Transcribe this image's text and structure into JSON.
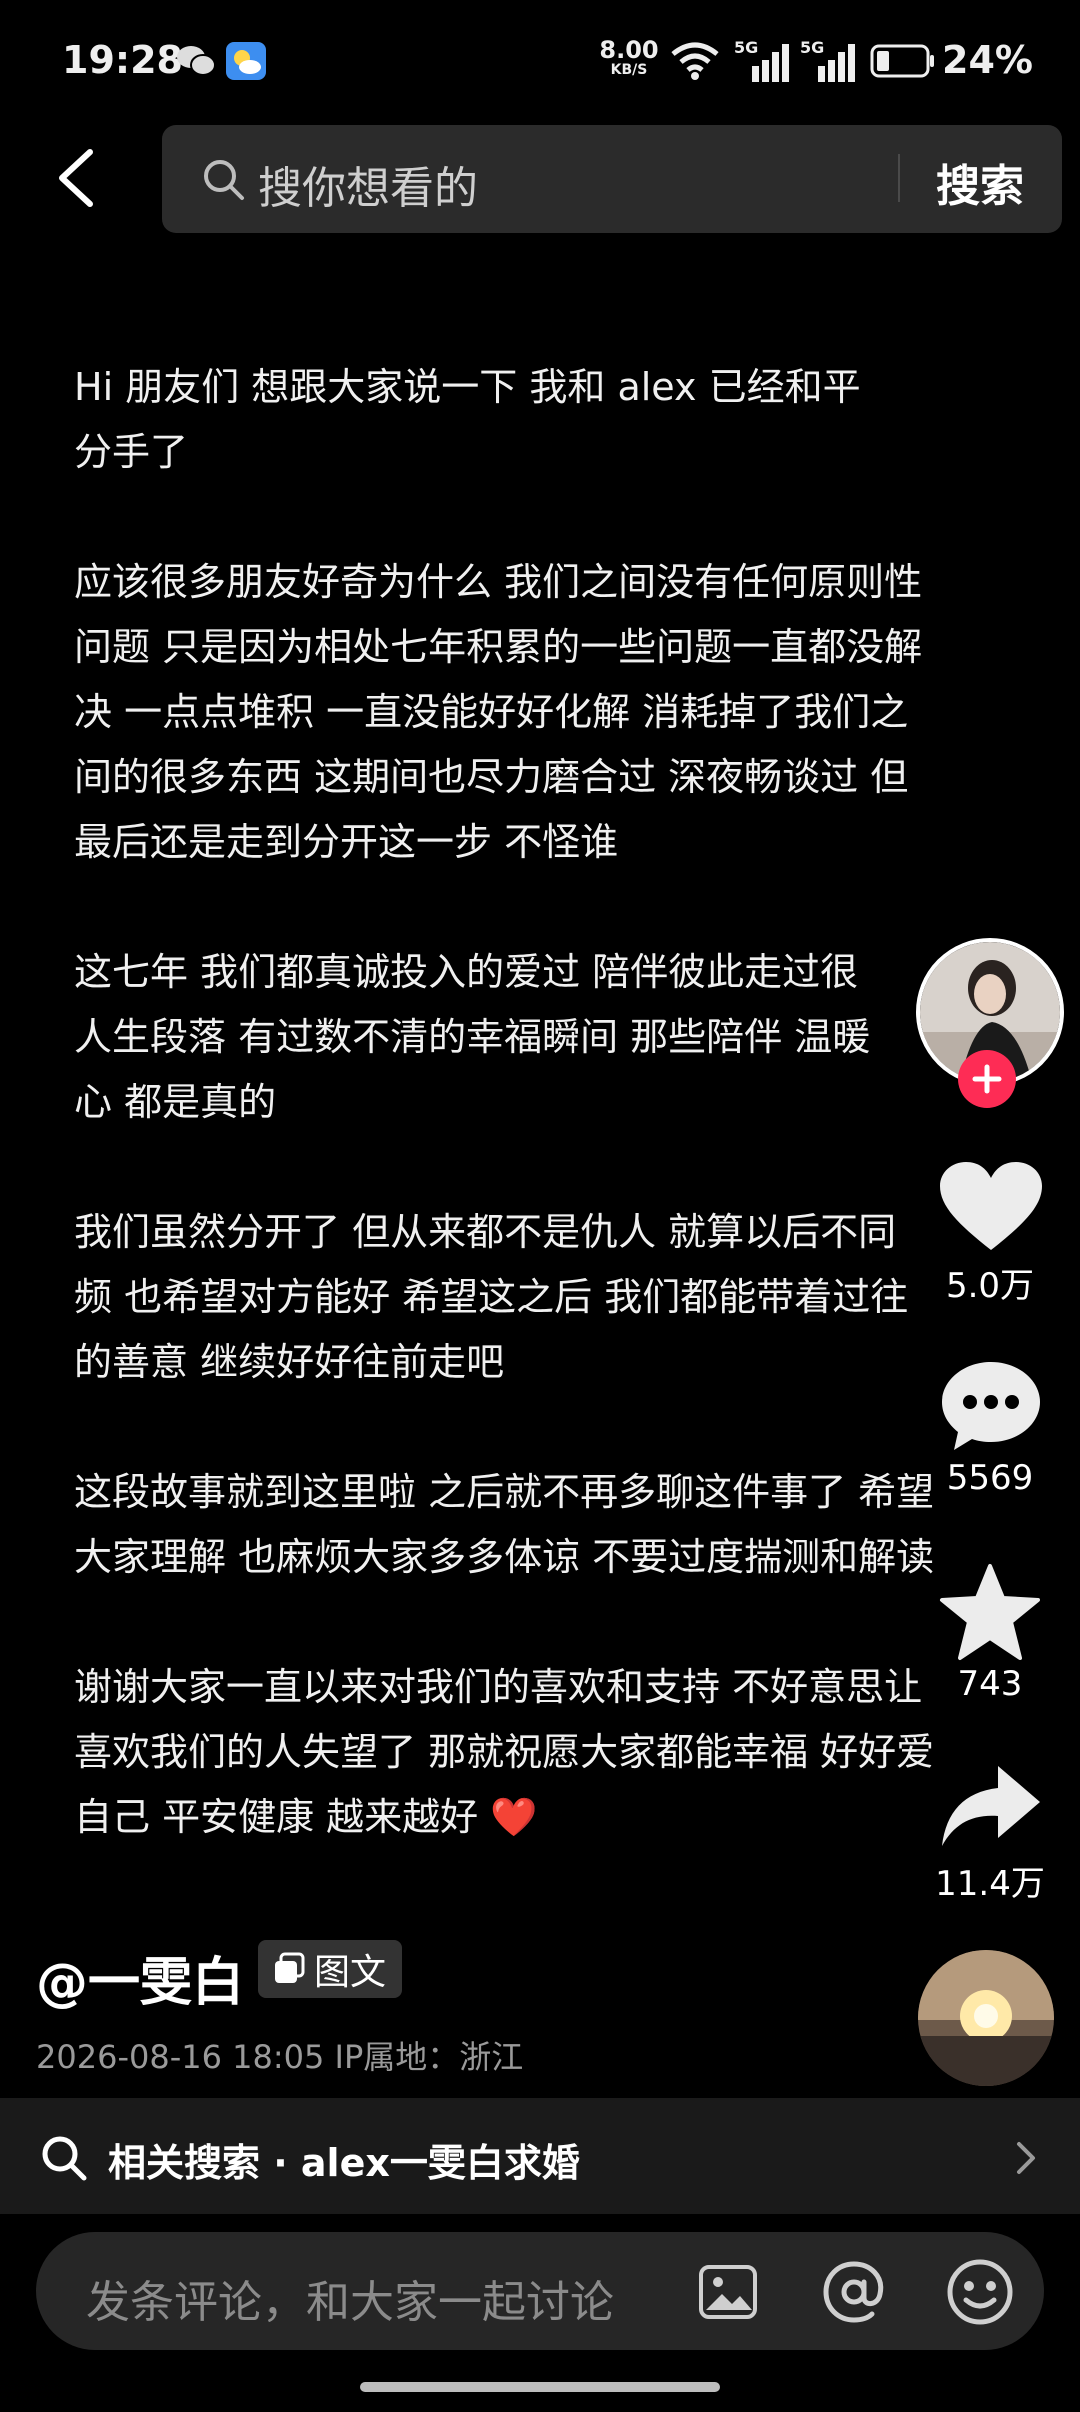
{
  "status_bar": {
    "time": "19:28",
    "net_speed_value": "8.00",
    "net_speed_unit": "KB/S",
    "sim1": "5G",
    "sim2": "5G",
    "battery": "24%"
  },
  "header": {
    "search_placeholder": "搜你想看的",
    "search_button": "搜索"
  },
  "article": {
    "paragraphs": [
      "Hi 朋友们 想跟大家说一下 我和 alex 已经和平\n分手了",
      "应该很多朋友好奇为什么 我们之间没有任何原则性\n问题 只是因为相处七年积累的一些问题一直都没解\n决 一点点堆积 一直没能好好化解 消耗掉了我们之\n间的很多东西 这期间也尽力磨合过 深夜畅谈过 但\n最后还是走到分开这一步 不怪谁",
      "这七年 我们都真诚投入的爱过 陪伴彼此走过很\n人生段落 有过数不清的幸福瞬间 那些陪伴 温暖\n心 都是真的",
      "我们虽然分开了 但从来都不是仇人  就算以后不同\n频 也希望对方能好 希望这之后 我们都能带着过往\n的善意 继续好好往前走吧",
      "这段故事就到这里啦 之后就不再多聊这件事了 希望\n大家理解 也麻烦大家多多体谅 不要过度揣测和解读",
      "谢谢大家一直以来对我们的喜欢和支持 不好意思让\n喜欢我们的人失望了 那就祝愿大家都能幸福 好好爱\n自己 平安健康 越来越好 ❤️"
    ]
  },
  "rail": {
    "likes": "5.0万",
    "comments": "5569",
    "favorites": "743",
    "shares": "11.4万"
  },
  "author": {
    "name": "@一雯白",
    "type_tag": "图文",
    "meta": "2026-08-16 18:05  IP属地：浙江"
  },
  "related": {
    "label": "相关搜索 · alex一雯白求婚"
  },
  "comment": {
    "placeholder": "发条评论，和大家一起讨论"
  },
  "colors": {
    "accent": "#fe2c55",
    "background": "#000000"
  }
}
